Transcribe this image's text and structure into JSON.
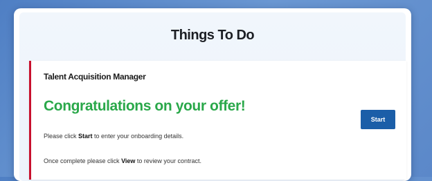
{
  "panel": {
    "title": "Things To Do"
  },
  "task": {
    "role": "Talent Acquisition Manager",
    "heading": "Congratulations on your offer!",
    "line1": {
      "before": "Please click ",
      "bold": "Start",
      "after": " to enter your onboarding details."
    },
    "line2": {
      "before": "Once complete please click ",
      "bold": "View",
      "after": " to review your contract."
    },
    "button_label": "Start"
  },
  "colors": {
    "accent_red": "#c8102e",
    "heading_green": "#2aa84a",
    "button_blue": "#1b5ea8",
    "background_blue": "#5b88c9"
  }
}
